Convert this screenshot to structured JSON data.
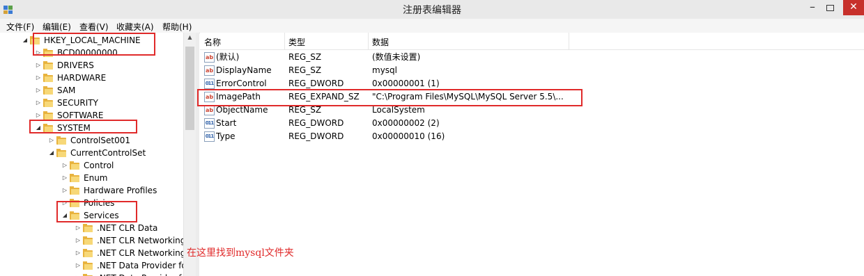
{
  "window": {
    "title": "注册表编辑器",
    "minimize_glyph": "–",
    "close_glyph": "✕"
  },
  "menu": [
    "文件(F)",
    "编辑(E)",
    "查看(V)",
    "收藏夹(A)",
    "帮助(H)"
  ],
  "tree": {
    "expanded_arrow": "◢",
    "collapsed_arrow": "▷",
    "nodes": [
      {
        "label": "HKEY_LOCAL_MACHINE",
        "expanded": true
      },
      {
        "label": "BCD00000000",
        "expanded": false
      },
      {
        "label": "DRIVERS",
        "expanded": false
      },
      {
        "label": "HARDWARE",
        "expanded": false
      },
      {
        "label": "SAM",
        "expanded": false
      },
      {
        "label": "SECURITY",
        "expanded": false
      },
      {
        "label": "SOFTWARE",
        "expanded": false
      },
      {
        "label": "SYSTEM",
        "expanded": true
      },
      {
        "label": "ControlSet001",
        "expanded": false
      },
      {
        "label": "CurrentControlSet",
        "expanded": true
      },
      {
        "label": "Control",
        "expanded": false
      },
      {
        "label": "Enum",
        "expanded": false
      },
      {
        "label": "Hardware Profiles",
        "expanded": false
      },
      {
        "label": "Policies",
        "expanded": false
      },
      {
        "label": "Services",
        "expanded": true
      },
      {
        "label": ".NET CLR Data",
        "expanded": false
      },
      {
        "label": ".NET CLR Networking",
        "expanded": false
      },
      {
        "label": ".NET CLR Networking",
        "expanded": false
      },
      {
        "label": ".NET Data Provider fo",
        "expanded": false
      },
      {
        "label": ".NET Data Provider fo",
        "expanded": false
      }
    ]
  },
  "scrollbar": {
    "up_glyph": "▲"
  },
  "list": {
    "columns": [
      "名称",
      "类型",
      "数据"
    ],
    "rows": [
      {
        "icon": "ab",
        "name": "(默认)",
        "type": "REG_SZ",
        "data": "(数值未设置)"
      },
      {
        "icon": "ab",
        "name": "DisplayName",
        "type": "REG_SZ",
        "data": "mysql"
      },
      {
        "icon": "bin",
        "name": "ErrorControl",
        "type": "REG_DWORD",
        "data": "0x00000001 (1)"
      },
      {
        "icon": "ab",
        "name": "ImagePath",
        "type": "REG_EXPAND_SZ",
        "data": "\"C:\\Program Files\\MySQL\\MySQL Server 5.5\\..."
      },
      {
        "icon": "ab",
        "name": "ObjectName",
        "type": "REG_SZ",
        "data": "LocalSystem"
      },
      {
        "icon": "bin",
        "name": "Start",
        "type": "REG_DWORD",
        "data": "0x00000002 (2)"
      },
      {
        "icon": "bin",
        "name": "Type",
        "type": "REG_DWORD",
        "data": "0x00000010 (16)"
      }
    ],
    "icon_text": {
      "ab": "ab",
      "bin": "011"
    }
  },
  "annotation": "在这里找到mysql文件夹",
  "colors": {
    "highlight_box": "#e02a2a",
    "close_button": "#c7302b"
  }
}
